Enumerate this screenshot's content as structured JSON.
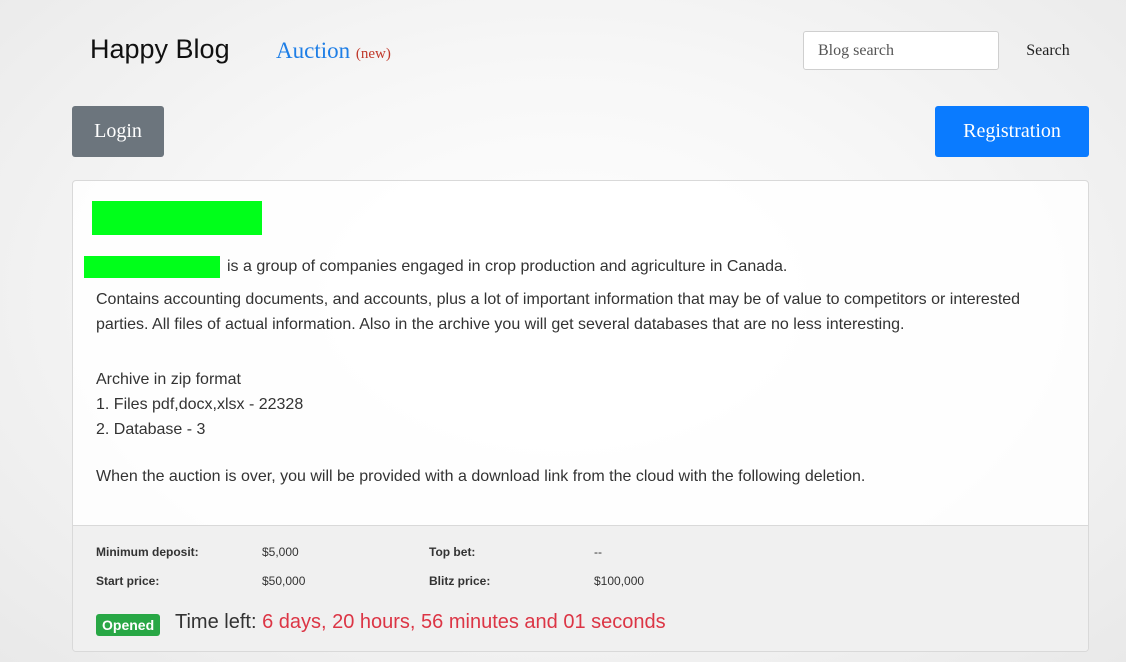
{
  "header": {
    "brand": "Happy Blog",
    "auction_label": "Auction",
    "auction_badge": "(new)",
    "search_placeholder": "Blog search",
    "search_button": "Search"
  },
  "actions": {
    "login": "Login",
    "registration": "Registration"
  },
  "post": {
    "intro": "is a group of companies engaged in crop production and agriculture in Canada.",
    "description": "Contains accounting documents, and accounts, plus a lot of important information that may be of value to competitors or interested parties. All files of actual information. Also in the archive you will get several databases that are no less interesting.",
    "archive_heading": "Archive in zip format",
    "archive_items": [
      "1. Files pdf,docx,xlsx - 22328",
      "2. Database - 3"
    ],
    "closing_note": "When the auction is over, you will be provided with a download link from the cloud with the following deletion."
  },
  "auction": {
    "min_deposit_label": "Minimum deposit:",
    "min_deposit_value": "$5,000",
    "top_bet_label": "Top bet:",
    "top_bet_value": "--",
    "start_price_label": "Start price:",
    "start_price_value": "$50,000",
    "blitz_price_label": "Blitz price:",
    "blitz_price_value": "$100,000",
    "status": "Opened",
    "time_left_label": "Time left:",
    "time_left_value": "6 days, 20 hours, 56 minutes and 01 seconds"
  },
  "colors": {
    "primary": "#0a7bff",
    "secondary": "#6c757d",
    "success": "#28a745",
    "danger": "#dc3545",
    "redaction": "#00ff1a"
  }
}
